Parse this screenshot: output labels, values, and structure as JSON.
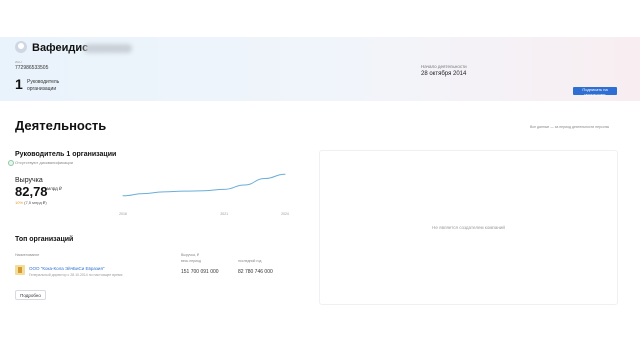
{
  "header": {
    "name": "Вафеидис",
    "inn_label": "ИНН",
    "inn": "772986533505",
    "lead_count": "1",
    "lead_text": "Руководитель организации",
    "start_label": "Начало деятельности",
    "start_date": "28 октября 2014",
    "monitor_button": "Подписать на мониторинг"
  },
  "activity": {
    "title": "Деятельность",
    "breadcrumbs": "Все данные — за период деятельности персоны"
  },
  "lead": {
    "title": "Руководитель 1 организации",
    "status": "Отсутствуют дисквалификации",
    "revenue_label": "Выручка",
    "revenue_value": "82,78",
    "revenue_unit": "млрд ₽",
    "revenue_change_pct": "10%",
    "revenue_change_abs": "(7,5 млрд ₽)"
  },
  "chart_data": {
    "type": "line",
    "categories": [
      "2016",
      "2021",
      "2024"
    ],
    "x": [
      2016,
      2017,
      2018,
      2019,
      2020,
      2021,
      2022,
      2023,
      2024
    ],
    "values": [
      0.2,
      0.26,
      0.31,
      0.33,
      0.34,
      0.38,
      0.5,
      0.68,
      0.8
    ],
    "title": "",
    "xlabel": "",
    "ylabel": "",
    "grid": false,
    "color": "#6aaed9"
  },
  "top_orgs": {
    "title": "Топ организаций",
    "columns": {
      "name": "Наименование",
      "revenue": "Выручка, ₽",
      "revenue_sub": "весь период",
      "last_year": "последний год"
    },
    "rows": [
      {
        "name": "ООО \"Кока-Кола ЭйчБиСи Евразия\"",
        "role": "Генеральный директор с 28.10.2014 по настоящее время",
        "revenue": "151 700 091 000",
        "last_year": "82 780 746 000"
      }
    ],
    "more_button": "Подробно"
  },
  "side_panel": {
    "text": "Не является создателем компаний"
  }
}
